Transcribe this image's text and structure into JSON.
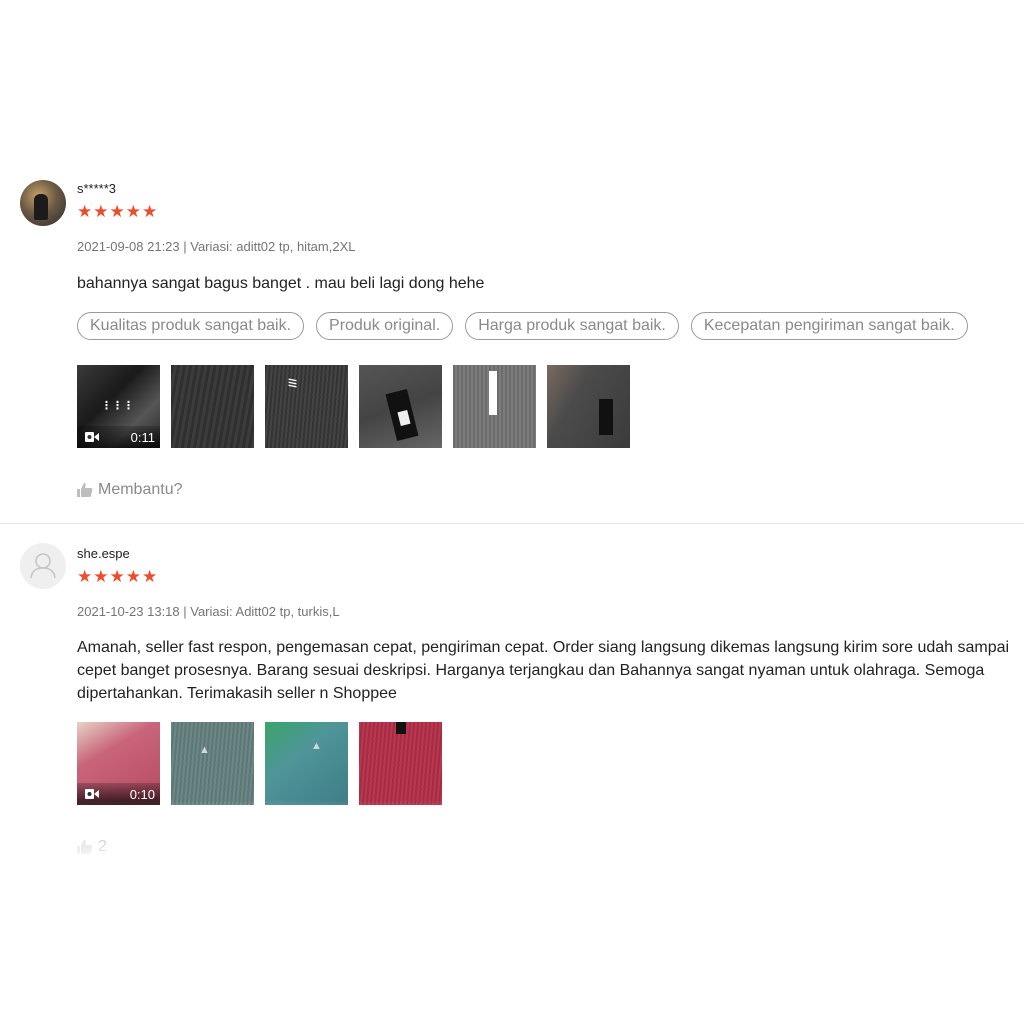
{
  "reviews": [
    {
      "username": "s*****3",
      "stars": "★★★★★",
      "rating": 5,
      "meta": "2021-09-08 21:23 | Variasi: aditt02 tp, hitam,2XL",
      "comment": "bahannya sangat bagus banget . mau beli lagi dong hehe",
      "tags": [
        "Kualitas produk sangat baik.",
        "Produk original.",
        "Harga produk sangat baik.",
        "Kecepatan pengiriman sangat baik."
      ],
      "video_duration": "0:11",
      "helpful": "Membantu?"
    },
    {
      "username": "she.espe",
      "stars": "★★★★★",
      "rating": 5,
      "meta": "2021-10-23 13:18 | Variasi: Aditt02 tp, turkis,L",
      "comment": "Amanah, seller fast respon, pengemasan cepat, pengiriman cepat. Order siang langsung dikemas  langsung kirim sore udah sampai cepet banget prosesnya. Barang sesuai deskripsi. Harganya terjangkau dan Bahannya sangat nyaman untuk olahraga. Semoga dipertahankan. Terimakasih seller n Shoppee",
      "video_duration": "0:10",
      "helpful": "2"
    }
  ],
  "colors": {
    "star": "#ee4d2d",
    "muted": "#757575",
    "tag_border": "#9a9a9a"
  }
}
